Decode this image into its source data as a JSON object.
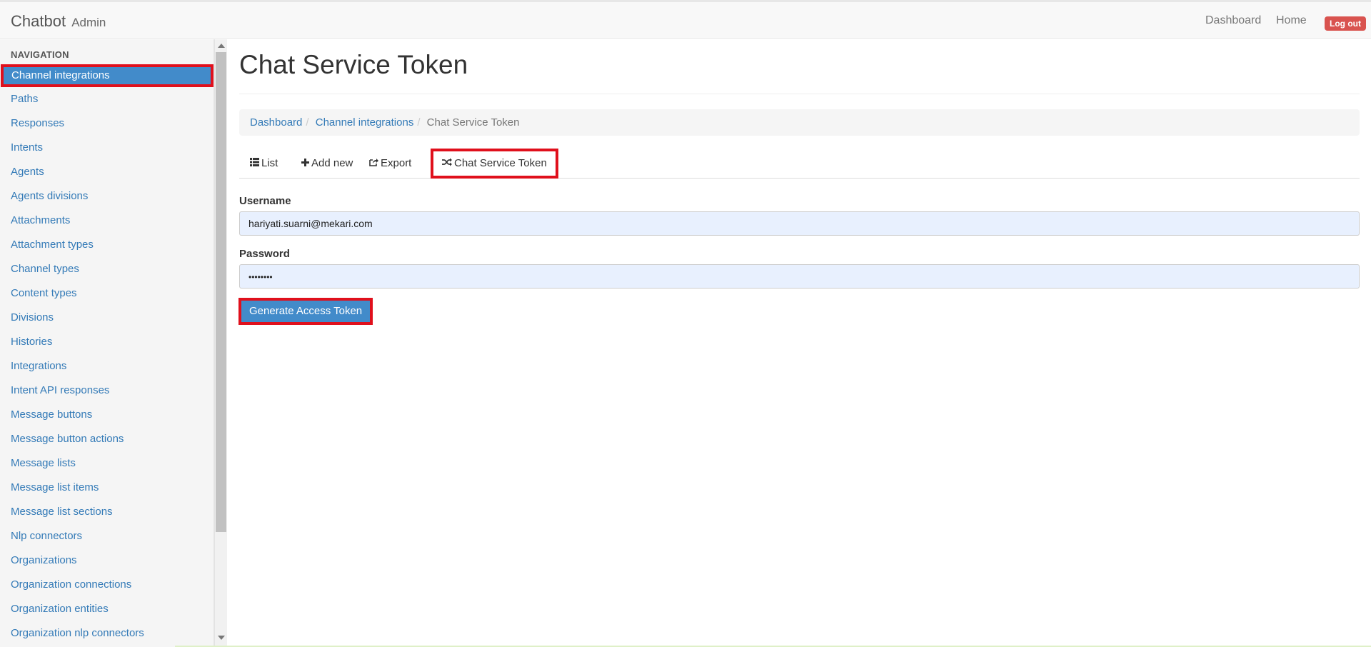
{
  "navbar": {
    "brand": "Chatbot",
    "brand_sub": "Admin",
    "links": [
      "Dashboard",
      "Home"
    ],
    "logout": "Log out"
  },
  "sidebar": {
    "header": "NAVIGATION",
    "items": [
      "Channel integrations",
      "Paths",
      "Responses",
      "Intents",
      "Agents",
      "Agents divisions",
      "Attachments",
      "Attachment types",
      "Channel types",
      "Content types",
      "Divisions",
      "Histories",
      "Integrations",
      "Intent API responses",
      "Message buttons",
      "Message button actions",
      "Message lists",
      "Message list items",
      "Message list sections",
      "Nlp connectors",
      "Organizations",
      "Organization connections",
      "Organization entities",
      "Organization nlp connectors"
    ],
    "active_index": 0
  },
  "main": {
    "title": "Chat Service Token",
    "breadcrumb": [
      "Dashboard",
      "Channel integrations",
      "Chat Service Token"
    ],
    "tabs": [
      {
        "label": "List",
        "icon": "list-icon"
      },
      {
        "label": "Add new",
        "icon": "plus-icon"
      },
      {
        "label": "Export",
        "icon": "export-icon"
      },
      {
        "label": "Chat Service Token",
        "icon": "random-icon"
      }
    ],
    "active_tab": 3,
    "form": {
      "username_label": "Username",
      "username_value": "hariyati.suarni@mekari.com",
      "password_label": "Password",
      "password_value": "••••••••",
      "submit_label": "Generate Access Token"
    }
  },
  "colors": {
    "primary": "#428bca",
    "link": "#337ab7",
    "danger": "#d9534f",
    "highlight": "#e0101c"
  }
}
